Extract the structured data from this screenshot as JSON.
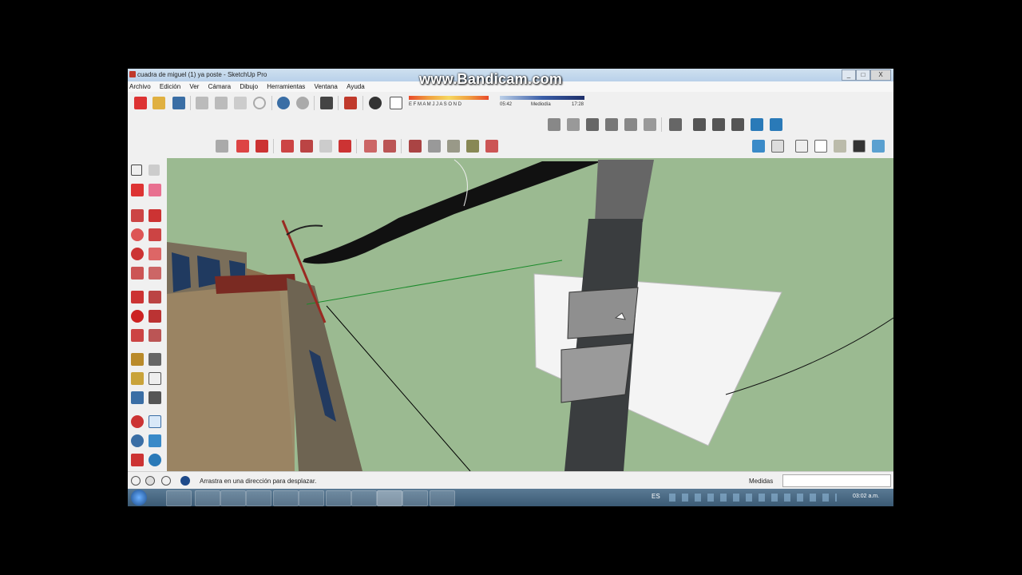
{
  "watermark": "www.Bandicam.com",
  "window": {
    "title": "cuadra de miguel (1) ya poste - SketchUp Pro",
    "controls": {
      "minimize": "_",
      "maximize": "□",
      "close": "X"
    }
  },
  "menu": [
    "Archivo",
    "Edición",
    "Ver",
    "Cámara",
    "Dibujo",
    "Herramientas",
    "Ventana",
    "Ayuda"
  ],
  "shadow_bar": {
    "months": "E F M A M J J A S O N D",
    "time_start": "05:42",
    "time_mid": "Mediodía",
    "time_end": "17:28"
  },
  "status": {
    "hint": "Arrastra en una dirección para desplazar.",
    "measure_label": "Medidas",
    "measure_value": ""
  },
  "taskbar": {
    "lang": "ES",
    "clock": "03:02 a.m."
  },
  "colors": {
    "viewport_green": "#9bba91",
    "accent_red": "#c0392b",
    "taskbar": "#3b5a74"
  }
}
